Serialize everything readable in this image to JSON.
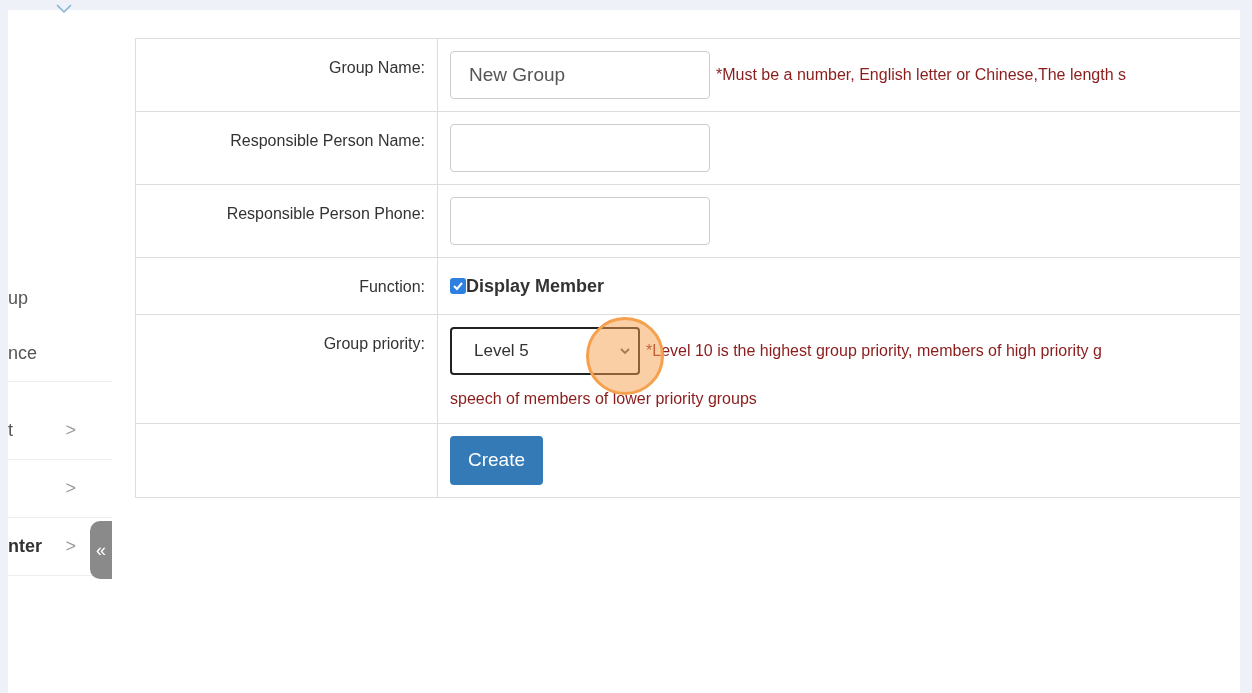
{
  "sidebar": {
    "items": [
      {
        "label": "up",
        "bold": false
      },
      {
        "label": "nce",
        "bold": false
      },
      {
        "label": "t",
        "bold": false,
        "chevron": ">"
      },
      {
        "chevron": ">"
      },
      {
        "label": "nter",
        "bold": true,
        "chevron": ">"
      }
    ],
    "collapse": "«"
  },
  "form": {
    "rows": [
      {
        "kind": "text",
        "label": "Group Name:",
        "value": "New Group",
        "hint": "*Must be a number, English letter or Chinese,The length s"
      },
      {
        "kind": "text",
        "label": "Responsible Person Name:",
        "value": ""
      },
      {
        "kind": "text",
        "label": "Responsible Person Phone:",
        "value": ""
      },
      {
        "kind": "checkbox",
        "label": "Function:",
        "option": "Display Member",
        "checked": true
      },
      {
        "kind": "select",
        "label": "Group priority:",
        "value": "Level 5",
        "hint": "*Level 10 is the highest group priority, members of high priority g",
        "hint_line2": "speech of members of lower priority groups"
      },
      {
        "kind": "button",
        "label": "",
        "button": "Create"
      }
    ]
  }
}
